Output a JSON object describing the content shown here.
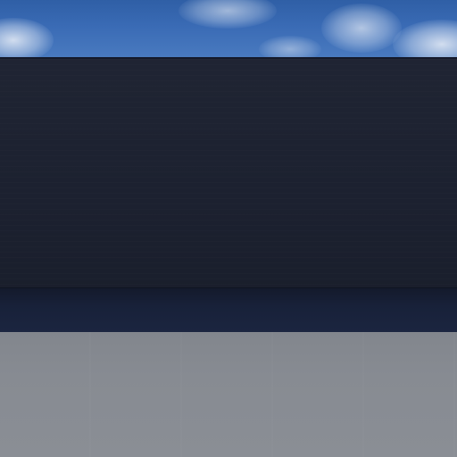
{
  "scene": {
    "type": "3d-game-viewport",
    "elements": [
      "sky",
      "wall",
      "ledge",
      "floor"
    ],
    "colors": {
      "sky": "#3a6bb5",
      "clouds": "#e6ecf5",
      "wall": "#1c2130",
      "ledge": "#182139",
      "floor": "#878b92"
    }
  }
}
